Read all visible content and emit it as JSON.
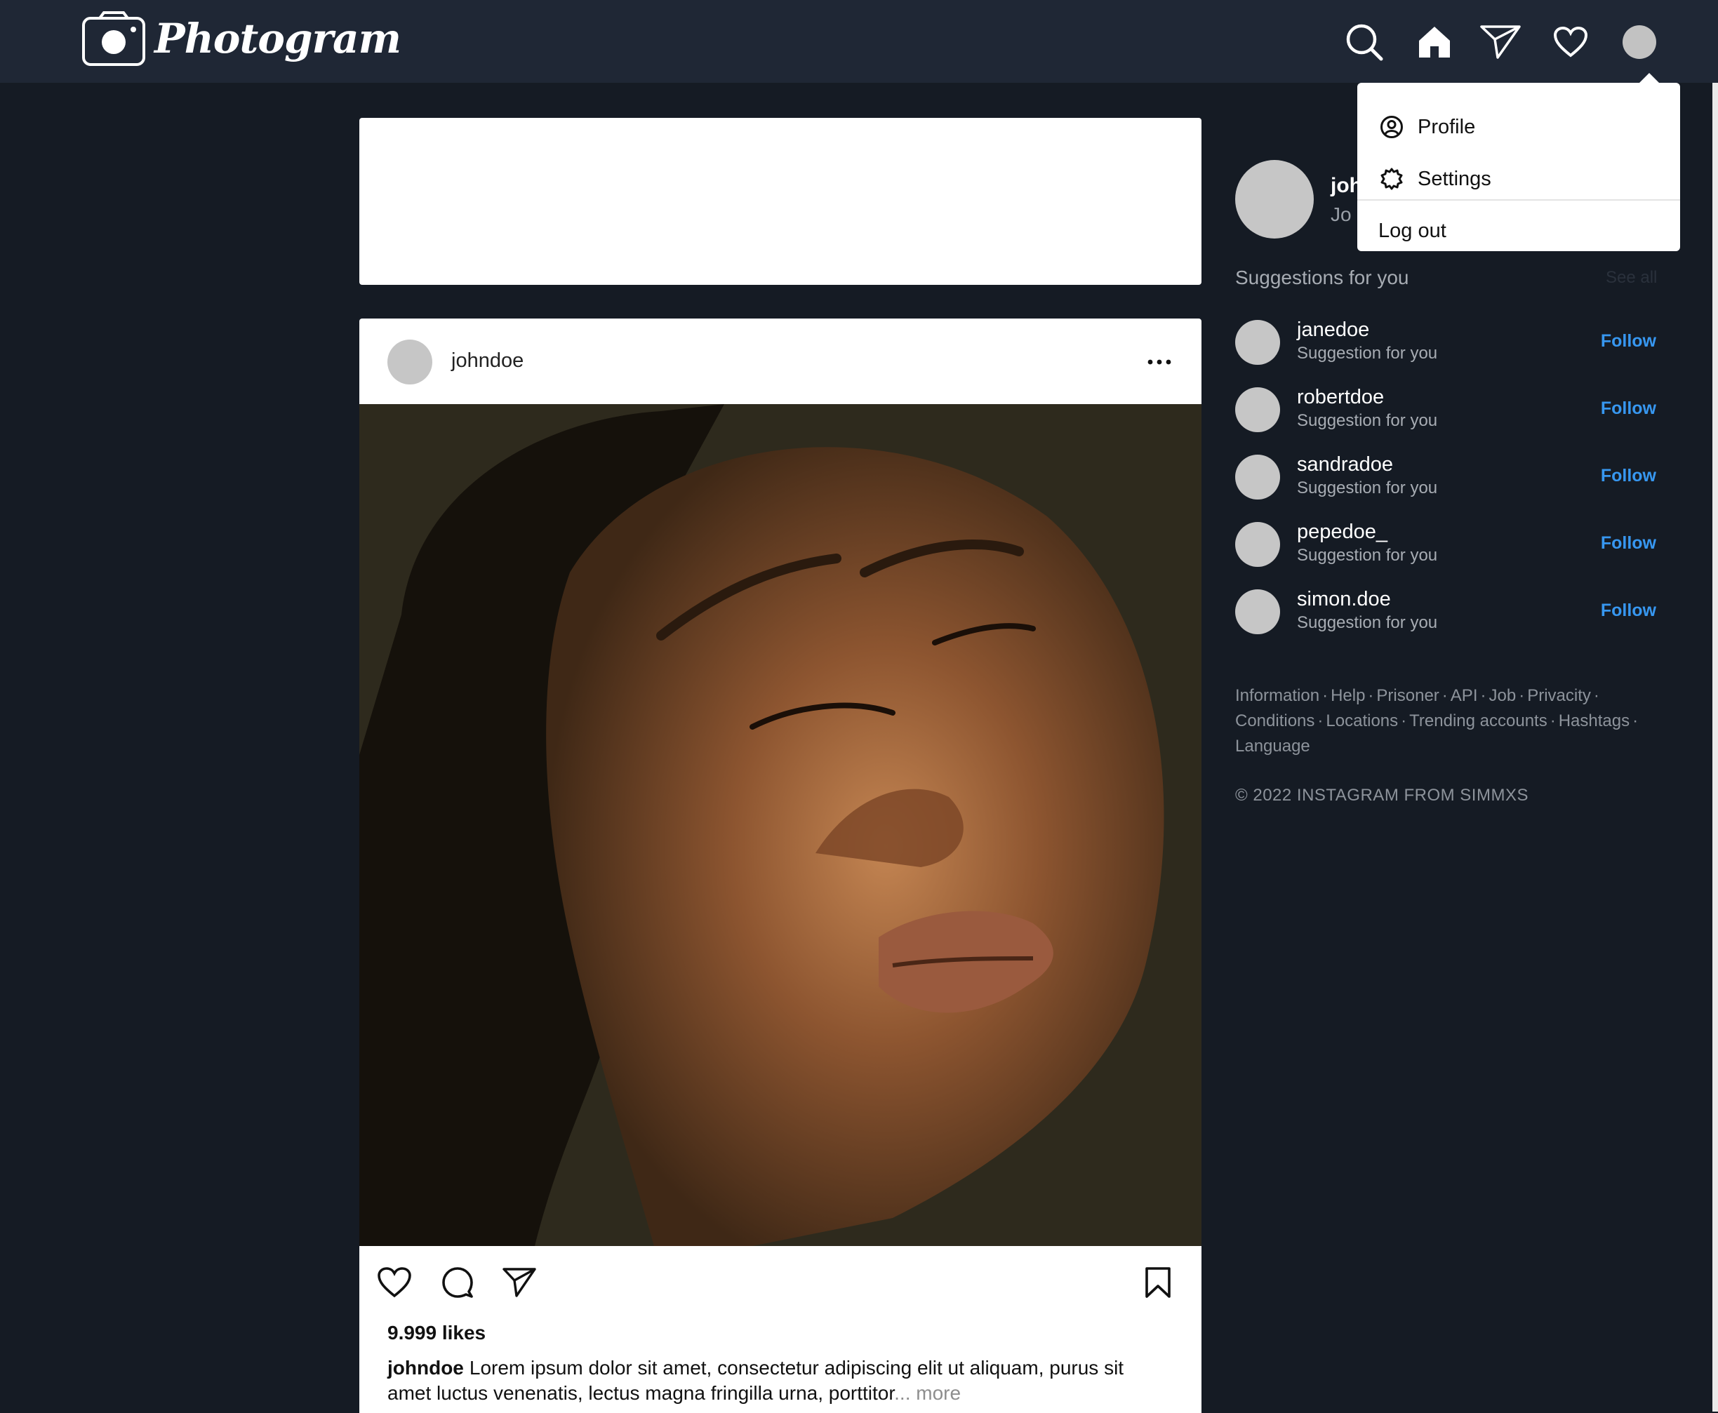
{
  "app": {
    "name": "Photogram"
  },
  "nav": {
    "icons": [
      "search-icon",
      "home-icon",
      "send-icon",
      "heart-icon"
    ]
  },
  "dropdown": {
    "items": [
      {
        "label": "Profile",
        "icon": "profile-icon"
      },
      {
        "label": "Settings",
        "icon": "settings-icon"
      },
      {
        "label": "Log out"
      }
    ]
  },
  "current_user": {
    "username_partial": "joh",
    "name_partial": "Jo"
  },
  "post": {
    "username": "johndoe",
    "likes": "9.999 likes",
    "caption_user": "johndoe",
    "caption_text": "Lorem ipsum dolor sit amet, consectetur adipiscing elit ut aliquam, purus sit amet luctus venenatis, lectus magna fringilla urna, porttitor",
    "more_label": "... more"
  },
  "suggestions": {
    "title": "Suggestions for you",
    "see_all": "See all",
    "items": [
      {
        "username": "janedoe",
        "subtitle": "Suggestion for you",
        "action": "Follow"
      },
      {
        "username": "robertdoe",
        "subtitle": "Suggestion for you",
        "action": "Follow"
      },
      {
        "username": "sandradoe",
        "subtitle": "Suggestion for you",
        "action": "Follow"
      },
      {
        "username": "pepedoe_",
        "subtitle": "Suggestion for you",
        "action": "Follow"
      },
      {
        "username": "simon.doe",
        "subtitle": "Suggestion for you",
        "action": "Follow"
      }
    ]
  },
  "footer": {
    "links": [
      "Information",
      "Help",
      "Prisoner",
      "API",
      "Job",
      "Privacity",
      "Conditions",
      "Locations",
      "Trending accounts",
      "Hashtags",
      "Language"
    ],
    "copyright": "© 2022 INSTAGRAM FROM SIMMXS"
  },
  "colors": {
    "background": "#151b24",
    "topbar": "#1f2735",
    "follow": "#3797f0"
  }
}
